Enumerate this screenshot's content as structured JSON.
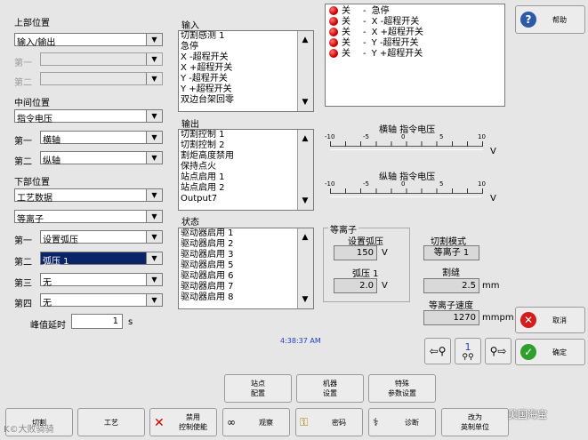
{
  "upper": {
    "title": "上部位置",
    "select": "输入/输出",
    "first_label": "第一",
    "second_label": "第二"
  },
  "middle": {
    "title": "中间位置",
    "select": "指令电压",
    "first_label": "第一",
    "first_val": "横轴",
    "second_label": "第二",
    "second_val": "纵轴"
  },
  "lower": {
    "title": "下部位置",
    "select1": "工艺数据",
    "select2": "等离子",
    "first_label": "第一",
    "first_val": "设置弧压",
    "second_label": "第二",
    "second_val": "弧压 1",
    "third_label": "第三",
    "third_val": "无",
    "fourth_label": "第四",
    "fourth_val": "无"
  },
  "peak": {
    "label": "峰值延时",
    "value": "1",
    "unit": "s"
  },
  "inputs": {
    "title": "输入",
    "items": [
      "切割感测 1",
      "急停",
      "X -超程开关",
      "X +超程开关",
      "Y -超程开关",
      "Y +超程开关",
      "双边台架回零"
    ]
  },
  "outputs": {
    "title": "输出",
    "items": [
      "切割控制 1",
      "切割控制 2",
      "割炬高度禁用",
      "保持点火",
      "站点启用 1",
      "站点启用 2",
      "Output7"
    ]
  },
  "status": {
    "title": "状态",
    "items": [
      "驱动器启用 1",
      "驱动器启用 2",
      "驱动器启用 3",
      "驱动器启用 5",
      "驱动器启用 6",
      "驱动器启用 7",
      "驱动器启用 8"
    ]
  },
  "io_status": [
    {
      "state": "关",
      "sep": "-",
      "name": "急停"
    },
    {
      "state": "关",
      "sep": "-",
      "name": "X -超程开关"
    },
    {
      "state": "关",
      "sep": "-",
      "name": "X +超程开关"
    },
    {
      "state": "关",
      "sep": "-",
      "name": "Y -超程开关"
    },
    {
      "state": "关",
      "sep": "-",
      "name": "Y +超程开关"
    }
  ],
  "help_label": "帮助",
  "h_scale": {
    "title": "横轴 指令电压",
    "ticks": [
      "-10",
      "-5",
      "0",
      "5",
      "10"
    ],
    "unit": "V"
  },
  "v_scale": {
    "title": "纵轴 指令电压",
    "ticks": [
      "-10",
      "-5",
      "0",
      "5",
      "10"
    ],
    "unit": "V"
  },
  "plasma": {
    "title": "等离子",
    "set_arc_label": "设置弧压",
    "set_arc_value": "150",
    "set_arc_unit": "V",
    "arc1_label": "弧压 1",
    "arc1_value": "2.0",
    "arc1_unit": "V"
  },
  "cut_mode": {
    "label": "切割模式",
    "value": "等离子 1",
    "kerf_label": "割缝",
    "kerf_value": "2.5",
    "kerf_unit": "mm",
    "speed_label": "等离子速度",
    "speed_value": "1270",
    "speed_unit": "mmpm"
  },
  "time": "4:38:37 AM",
  "cancel_label": "取消",
  "ok_label": "确定",
  "mid_number": "1",
  "softkeys_top": [
    "站点\n配置",
    "机器\n设置",
    "特殊\n参数设置"
  ],
  "softkeys_bottom": [
    "切割",
    "工艺",
    "禁用\n控制使能",
    "观察",
    "密码",
    "诊断",
    "改为\n英制单位"
  ],
  "watermark_left": "K©大败骑骑",
  "watermark_right": "美国海宝"
}
